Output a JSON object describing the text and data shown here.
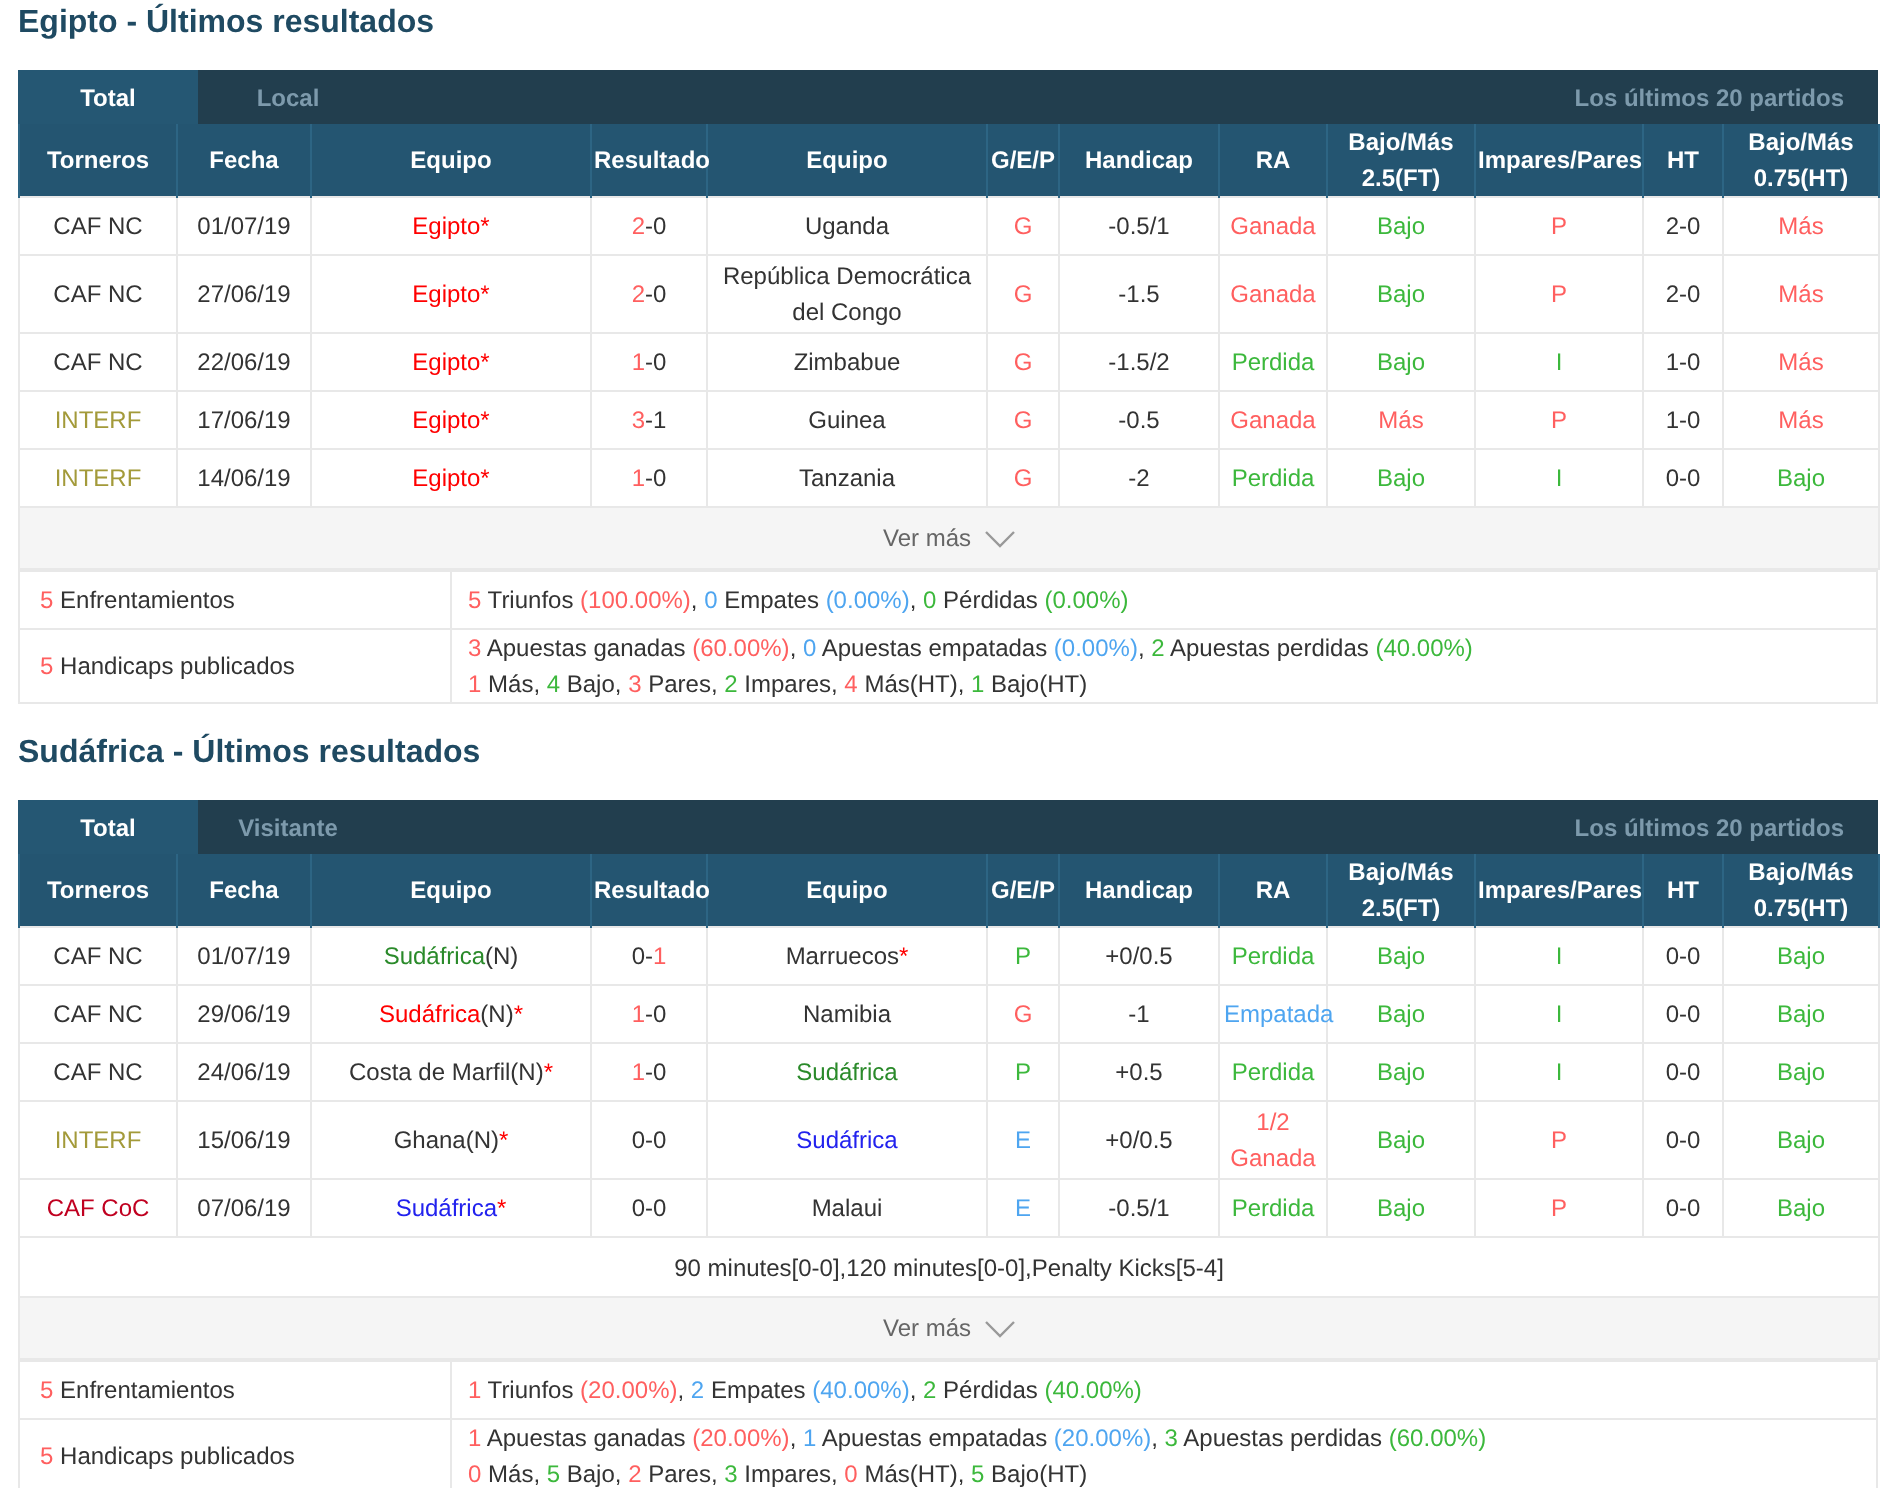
{
  "sections": [
    {
      "title": "Egipto - Últimos resultados",
      "tabs": [
        {
          "label": "Total",
          "selected": true
        },
        {
          "label": "Local",
          "selected": false
        }
      ],
      "range_label": "Los últimos 20 partidos",
      "columns": [
        "Torneros",
        "Fecha",
        "Equipo",
        "Resultado",
        "Equipo",
        "G/E/P",
        "Handicap",
        "RA",
        "Bajo/Más 2.5(FT)",
        "Impares/Pares",
        "HT",
        "Bajo/Más 0.75(HT)"
      ],
      "rows": [
        {
          "cells": [
            [
              {
                "text": "CAF NC",
                "color": "#333333"
              }
            ],
            [
              {
                "text": "01/07/19",
                "color": "#333333"
              }
            ],
            [
              {
                "text": "Egipto*",
                "color": "#ff0000"
              }
            ],
            [
              {
                "text": "2",
                "color": "#ff5f5f"
              },
              {
                "text": "-0",
                "color": "#333333"
              }
            ],
            [
              {
                "text": "Uganda",
                "color": "#333333"
              }
            ],
            [
              {
                "text": "G",
                "color": "#ff5f5f"
              }
            ],
            [
              {
                "text": "-0.5/1",
                "color": "#333333"
              }
            ],
            [
              {
                "text": "Ganada",
                "color": "#ff5f5f"
              }
            ],
            [
              {
                "text": "Bajo",
                "color": "#3cb83c"
              }
            ],
            [
              {
                "text": "P",
                "color": "#ff5f5f"
              }
            ],
            [
              {
                "text": "2-0",
                "color": "#333333"
              }
            ],
            [
              {
                "text": "Más",
                "color": "#ff5f5f"
              }
            ]
          ]
        },
        {
          "cells": [
            [
              {
                "text": "CAF NC",
                "color": "#333333"
              }
            ],
            [
              {
                "text": "27/06/19",
                "color": "#333333"
              }
            ],
            [
              {
                "text": "Egipto*",
                "color": "#ff0000"
              }
            ],
            [
              {
                "text": "2",
                "color": "#ff5f5f"
              },
              {
                "text": "-0",
                "color": "#333333"
              }
            ],
            [
              {
                "text": "República Democrática del Congo",
                "color": "#333333"
              }
            ],
            [
              {
                "text": "G",
                "color": "#ff5f5f"
              }
            ],
            [
              {
                "text": "-1.5",
                "color": "#333333"
              }
            ],
            [
              {
                "text": "Ganada",
                "color": "#ff5f5f"
              }
            ],
            [
              {
                "text": "Bajo",
                "color": "#3cb83c"
              }
            ],
            [
              {
                "text": "P",
                "color": "#ff5f5f"
              }
            ],
            [
              {
                "text": "2-0",
                "color": "#333333"
              }
            ],
            [
              {
                "text": "Más",
                "color": "#ff5f5f"
              }
            ]
          ]
        },
        {
          "cells": [
            [
              {
                "text": "CAF NC",
                "color": "#333333"
              }
            ],
            [
              {
                "text": "22/06/19",
                "color": "#333333"
              }
            ],
            [
              {
                "text": "Egipto*",
                "color": "#ff0000"
              }
            ],
            [
              {
                "text": "1",
                "color": "#ff5f5f"
              },
              {
                "text": "-0",
                "color": "#333333"
              }
            ],
            [
              {
                "text": "Zimbabue",
                "color": "#333333"
              }
            ],
            [
              {
                "text": "G",
                "color": "#ff5f5f"
              }
            ],
            [
              {
                "text": "-1.5/2",
                "color": "#333333"
              }
            ],
            [
              {
                "text": "Perdida",
                "color": "#3cb83c"
              }
            ],
            [
              {
                "text": "Bajo",
                "color": "#3cb83c"
              }
            ],
            [
              {
                "text": "I",
                "color": "#3cb83c"
              }
            ],
            [
              {
                "text": "1-0",
                "color": "#333333"
              }
            ],
            [
              {
                "text": "Más",
                "color": "#ff5f5f"
              }
            ]
          ]
        },
        {
          "cells": [
            [
              {
                "text": "INTERF",
                "color": "#a39a3a"
              }
            ],
            [
              {
                "text": "17/06/19",
                "color": "#333333"
              }
            ],
            [
              {
                "text": "Egipto*",
                "color": "#ff0000"
              }
            ],
            [
              {
                "text": "3",
                "color": "#ff5f5f"
              },
              {
                "text": "-1",
                "color": "#333333"
              }
            ],
            [
              {
                "text": "Guinea",
                "color": "#333333"
              }
            ],
            [
              {
                "text": "G",
                "color": "#ff5f5f"
              }
            ],
            [
              {
                "text": "-0.5",
                "color": "#333333"
              }
            ],
            [
              {
                "text": "Ganada",
                "color": "#ff5f5f"
              }
            ],
            [
              {
                "text": "Más",
                "color": "#ff5f5f"
              }
            ],
            [
              {
                "text": "P",
                "color": "#ff5f5f"
              }
            ],
            [
              {
                "text": "1-0",
                "color": "#333333"
              }
            ],
            [
              {
                "text": "Más",
                "color": "#ff5f5f"
              }
            ]
          ]
        },
        {
          "cells": [
            [
              {
                "text": "INTERF",
                "color": "#a39a3a"
              }
            ],
            [
              {
                "text": "14/06/19",
                "color": "#333333"
              }
            ],
            [
              {
                "text": "Egipto*",
                "color": "#ff0000"
              }
            ],
            [
              {
                "text": "1",
                "color": "#ff5f5f"
              },
              {
                "text": "-0",
                "color": "#333333"
              }
            ],
            [
              {
                "text": "Tanzania",
                "color": "#333333"
              }
            ],
            [
              {
                "text": "G",
                "color": "#ff5f5f"
              }
            ],
            [
              {
                "text": "-2",
                "color": "#333333"
              }
            ],
            [
              {
                "text": "Perdida",
                "color": "#3cb83c"
              }
            ],
            [
              {
                "text": "Bajo",
                "color": "#3cb83c"
              }
            ],
            [
              {
                "text": "I",
                "color": "#3cb83c"
              }
            ],
            [
              {
                "text": "0-0",
                "color": "#333333"
              }
            ],
            [
              {
                "text": "Bajo",
                "color": "#3cb83c"
              }
            ]
          ]
        }
      ],
      "more_link": "Ver más",
      "summary": [
        {
          "label": [
            {
              "text": "5",
              "color": "#ff5f5f"
            },
            {
              "text": " Enfrentamientos",
              "color": "#333333"
            }
          ],
          "lines": [
            [
              {
                "text": "5",
                "color": "#ff5f5f"
              },
              {
                "text": " Triunfos ",
                "color": "#333333"
              },
              {
                "text": "(100.00%)",
                "color": "#ff5f5f"
              },
              {
                "text": ", ",
                "color": "#333333"
              },
              {
                "text": "0",
                "color": "#4ea5f0"
              },
              {
                "text": " Empates ",
                "color": "#333333"
              },
              {
                "text": "(0.00%)",
                "color": "#4ea5f0"
              },
              {
                "text": ", ",
                "color": "#333333"
              },
              {
                "text": "0",
                "color": "#3cb83c"
              },
              {
                "text": " Pérdidas ",
                "color": "#333333"
              },
              {
                "text": "(0.00%)",
                "color": "#3cb83c"
              }
            ]
          ]
        },
        {
          "label": [
            {
              "text": "5",
              "color": "#ff5f5f"
            },
            {
              "text": " Handicaps publicados",
              "color": "#333333"
            }
          ],
          "lines": [
            [
              {
                "text": "3",
                "color": "#ff5f5f"
              },
              {
                "text": " Apuestas ganadas ",
                "color": "#333333"
              },
              {
                "text": "(60.00%)",
                "color": "#ff5f5f"
              },
              {
                "text": ", ",
                "color": "#333333"
              },
              {
                "text": "0",
                "color": "#4ea5f0"
              },
              {
                "text": " Apuestas empatadas ",
                "color": "#333333"
              },
              {
                "text": "(0.00%)",
                "color": "#4ea5f0"
              },
              {
                "text": ", ",
                "color": "#333333"
              },
              {
                "text": "2",
                "color": "#3cb83c"
              },
              {
                "text": " Apuestas perdidas ",
                "color": "#333333"
              },
              {
                "text": "(40.00%)",
                "color": "#3cb83c"
              }
            ],
            [
              {
                "text": "1",
                "color": "#ff5f5f"
              },
              {
                "text": " Más, ",
                "color": "#333333"
              },
              {
                "text": "4",
                "color": "#3cb83c"
              },
              {
                "text": " Bajo, ",
                "color": "#333333"
              },
              {
                "text": "3",
                "color": "#ff5f5f"
              },
              {
                "text": " Pares, ",
                "color": "#333333"
              },
              {
                "text": "2",
                "color": "#3cb83c"
              },
              {
                "text": " Impares, ",
                "color": "#333333"
              },
              {
                "text": "4",
                "color": "#ff5f5f"
              },
              {
                "text": " Más(HT), ",
                "color": "#333333"
              },
              {
                "text": "1",
                "color": "#3cb83c"
              },
              {
                "text": " Bajo(HT)",
                "color": "#333333"
              }
            ]
          ]
        }
      ]
    },
    {
      "title": "Sudáfrica - Últimos resultados",
      "tabs": [
        {
          "label": "Total",
          "selected": true
        },
        {
          "label": "Visitante",
          "selected": false
        }
      ],
      "range_label": "Los últimos 20 partidos",
      "columns": [
        "Torneros",
        "Fecha",
        "Equipo",
        "Resultado",
        "Equipo",
        "G/E/P",
        "Handicap",
        "RA",
        "Bajo/Más 2.5(FT)",
        "Impares/Pares",
        "HT",
        "Bajo/Más 0.75(HT)"
      ],
      "rows": [
        {
          "cells": [
            [
              {
                "text": "CAF NC",
                "color": "#333333"
              }
            ],
            [
              {
                "text": "01/07/19",
                "color": "#333333"
              }
            ],
            [
              {
                "text": "Sudáfrica",
                "color": "#2a8a2a"
              },
              {
                "text": "(N)",
                "color": "#333333"
              }
            ],
            [
              {
                "text": "0-",
                "color": "#333333"
              },
              {
                "text": "1",
                "color": "#ff5f5f"
              }
            ],
            [
              {
                "text": "Marruecos",
                "color": "#333333"
              },
              {
                "text": "*",
                "color": "#ff0000"
              }
            ],
            [
              {
                "text": "P",
                "color": "#3cb83c"
              }
            ],
            [
              {
                "text": "+0/0.5",
                "color": "#333333"
              }
            ],
            [
              {
                "text": "Perdida",
                "color": "#3cb83c"
              }
            ],
            [
              {
                "text": "Bajo",
                "color": "#3cb83c"
              }
            ],
            [
              {
                "text": "I",
                "color": "#3cb83c"
              }
            ],
            [
              {
                "text": "0-0",
                "color": "#333333"
              }
            ],
            [
              {
                "text": "Bajo",
                "color": "#3cb83c"
              }
            ]
          ]
        },
        {
          "cells": [
            [
              {
                "text": "CAF NC",
                "color": "#333333"
              }
            ],
            [
              {
                "text": "29/06/19",
                "color": "#333333"
              }
            ],
            [
              {
                "text": "Sudáfrica",
                "color": "#ff0000"
              },
              {
                "text": "(N)",
                "color": "#333333"
              },
              {
                "text": "*",
                "color": "#ff0000"
              }
            ],
            [
              {
                "text": "1",
                "color": "#ff5f5f"
              },
              {
                "text": "-0",
                "color": "#333333"
              }
            ],
            [
              {
                "text": "Namibia",
                "color": "#333333"
              }
            ],
            [
              {
                "text": "G",
                "color": "#ff5f5f"
              }
            ],
            [
              {
                "text": "-1",
                "color": "#333333"
              }
            ],
            [
              {
                "text": "Empatada",
                "color": "#4ea5f0"
              }
            ],
            [
              {
                "text": "Bajo",
                "color": "#3cb83c"
              }
            ],
            [
              {
                "text": "I",
                "color": "#3cb83c"
              }
            ],
            [
              {
                "text": "0-0",
                "color": "#333333"
              }
            ],
            [
              {
                "text": "Bajo",
                "color": "#3cb83c"
              }
            ]
          ]
        },
        {
          "cells": [
            [
              {
                "text": "CAF NC",
                "color": "#333333"
              }
            ],
            [
              {
                "text": "24/06/19",
                "color": "#333333"
              }
            ],
            [
              {
                "text": "Costa de Marfil(N)",
                "color": "#333333"
              },
              {
                "text": "*",
                "color": "#ff0000"
              }
            ],
            [
              {
                "text": "1",
                "color": "#ff5f5f"
              },
              {
                "text": "-0",
                "color": "#333333"
              }
            ],
            [
              {
                "text": "Sudáfrica",
                "color": "#2a8a2a"
              }
            ],
            [
              {
                "text": "P",
                "color": "#3cb83c"
              }
            ],
            [
              {
                "text": "+0.5",
                "color": "#333333"
              }
            ],
            [
              {
                "text": "Perdida",
                "color": "#3cb83c"
              }
            ],
            [
              {
                "text": "Bajo",
                "color": "#3cb83c"
              }
            ],
            [
              {
                "text": "I",
                "color": "#3cb83c"
              }
            ],
            [
              {
                "text": "0-0",
                "color": "#333333"
              }
            ],
            [
              {
                "text": "Bajo",
                "color": "#3cb83c"
              }
            ]
          ]
        },
        {
          "cells": [
            [
              {
                "text": "INTERF",
                "color": "#a39a3a"
              }
            ],
            [
              {
                "text": "15/06/19",
                "color": "#333333"
              }
            ],
            [
              {
                "text": "Ghana(N)",
                "color": "#333333"
              },
              {
                "text": "*",
                "color": "#ff0000"
              }
            ],
            [
              {
                "text": "0-0",
                "color": "#333333"
              }
            ],
            [
              {
                "text": "Sudáfrica",
                "color": "#2222ee"
              }
            ],
            [
              {
                "text": "E",
                "color": "#4ea5f0"
              }
            ],
            [
              {
                "text": "+0/0.5",
                "color": "#333333"
              }
            ],
            [
              {
                "text": "1/2 Ganada",
                "color": "#ff5f5f"
              }
            ],
            [
              {
                "text": "Bajo",
                "color": "#3cb83c"
              }
            ],
            [
              {
                "text": "P",
                "color": "#ff5f5f"
              }
            ],
            [
              {
                "text": "0-0",
                "color": "#333333"
              }
            ],
            [
              {
                "text": "Bajo",
                "color": "#3cb83c"
              }
            ]
          ]
        },
        {
          "cells": [
            [
              {
                "text": "CAF CoC",
                "color": "#c00020"
              }
            ],
            [
              {
                "text": "07/06/19",
                "color": "#333333"
              }
            ],
            [
              {
                "text": "Sudáfrica",
                "color": "#2222ee"
              },
              {
                "text": "*",
                "color": "#ff0000"
              }
            ],
            [
              {
                "text": "0-0",
                "color": "#333333"
              }
            ],
            [
              {
                "text": "Malaui",
                "color": "#333333"
              }
            ],
            [
              {
                "text": "E",
                "color": "#4ea5f0"
              }
            ],
            [
              {
                "text": "-0.5/1",
                "color": "#333333"
              }
            ],
            [
              {
                "text": "Perdida",
                "color": "#3cb83c"
              }
            ],
            [
              {
                "text": "Bajo",
                "color": "#3cb83c"
              }
            ],
            [
              {
                "text": "P",
                "color": "#ff5f5f"
              }
            ],
            [
              {
                "text": "0-0",
                "color": "#333333"
              }
            ],
            [
              {
                "text": "Bajo",
                "color": "#3cb83c"
              }
            ]
          ]
        }
      ],
      "note": "90 minutes[0-0],120 minutes[0-0],Penalty Kicks[5-4]",
      "more_link": "Ver más",
      "summary": [
        {
          "label": [
            {
              "text": "5",
              "color": "#ff5f5f"
            },
            {
              "text": " Enfrentamientos",
              "color": "#333333"
            }
          ],
          "lines": [
            [
              {
                "text": "1",
                "color": "#ff5f5f"
              },
              {
                "text": " Triunfos ",
                "color": "#333333"
              },
              {
                "text": "(20.00%)",
                "color": "#ff5f5f"
              },
              {
                "text": ", ",
                "color": "#333333"
              },
              {
                "text": "2",
                "color": "#4ea5f0"
              },
              {
                "text": " Empates ",
                "color": "#333333"
              },
              {
                "text": "(40.00%)",
                "color": "#4ea5f0"
              },
              {
                "text": ", ",
                "color": "#333333"
              },
              {
                "text": "2",
                "color": "#3cb83c"
              },
              {
                "text": " Pérdidas ",
                "color": "#333333"
              },
              {
                "text": "(40.00%)",
                "color": "#3cb83c"
              }
            ]
          ]
        },
        {
          "label": [
            {
              "text": "5",
              "color": "#ff5f5f"
            },
            {
              "text": " Handicaps publicados",
              "color": "#333333"
            }
          ],
          "lines": [
            [
              {
                "text": "1",
                "color": "#ff5f5f"
              },
              {
                "text": " Apuestas ganadas ",
                "color": "#333333"
              },
              {
                "text": "(20.00%)",
                "color": "#ff5f5f"
              },
              {
                "text": ", ",
                "color": "#333333"
              },
              {
                "text": "1",
                "color": "#4ea5f0"
              },
              {
                "text": " Apuestas empatadas ",
                "color": "#333333"
              },
              {
                "text": "(20.00%)",
                "color": "#4ea5f0"
              },
              {
                "text": ", ",
                "color": "#333333"
              },
              {
                "text": "3",
                "color": "#3cb83c"
              },
              {
                "text": " Apuestas perdidas ",
                "color": "#333333"
              },
              {
                "text": "(60.00%)",
                "color": "#3cb83c"
              }
            ],
            [
              {
                "text": "0",
                "color": "#ff5f5f"
              },
              {
                "text": " Más, ",
                "color": "#333333"
              },
              {
                "text": "5",
                "color": "#3cb83c"
              },
              {
                "text": " Bajo, ",
                "color": "#333333"
              },
              {
                "text": "2",
                "color": "#ff5f5f"
              },
              {
                "text": " Pares, ",
                "color": "#333333"
              },
              {
                "text": "3",
                "color": "#3cb83c"
              },
              {
                "text": " Impares, ",
                "color": "#333333"
              },
              {
                "text": "0",
                "color": "#ff5f5f"
              },
              {
                "text": " Más(HT), ",
                "color": "#333333"
              },
              {
                "text": "5",
                "color": "#3cb83c"
              },
              {
                "text": " Bajo(HT)",
                "color": "#333333"
              }
            ]
          ]
        }
      ]
    }
  ]
}
